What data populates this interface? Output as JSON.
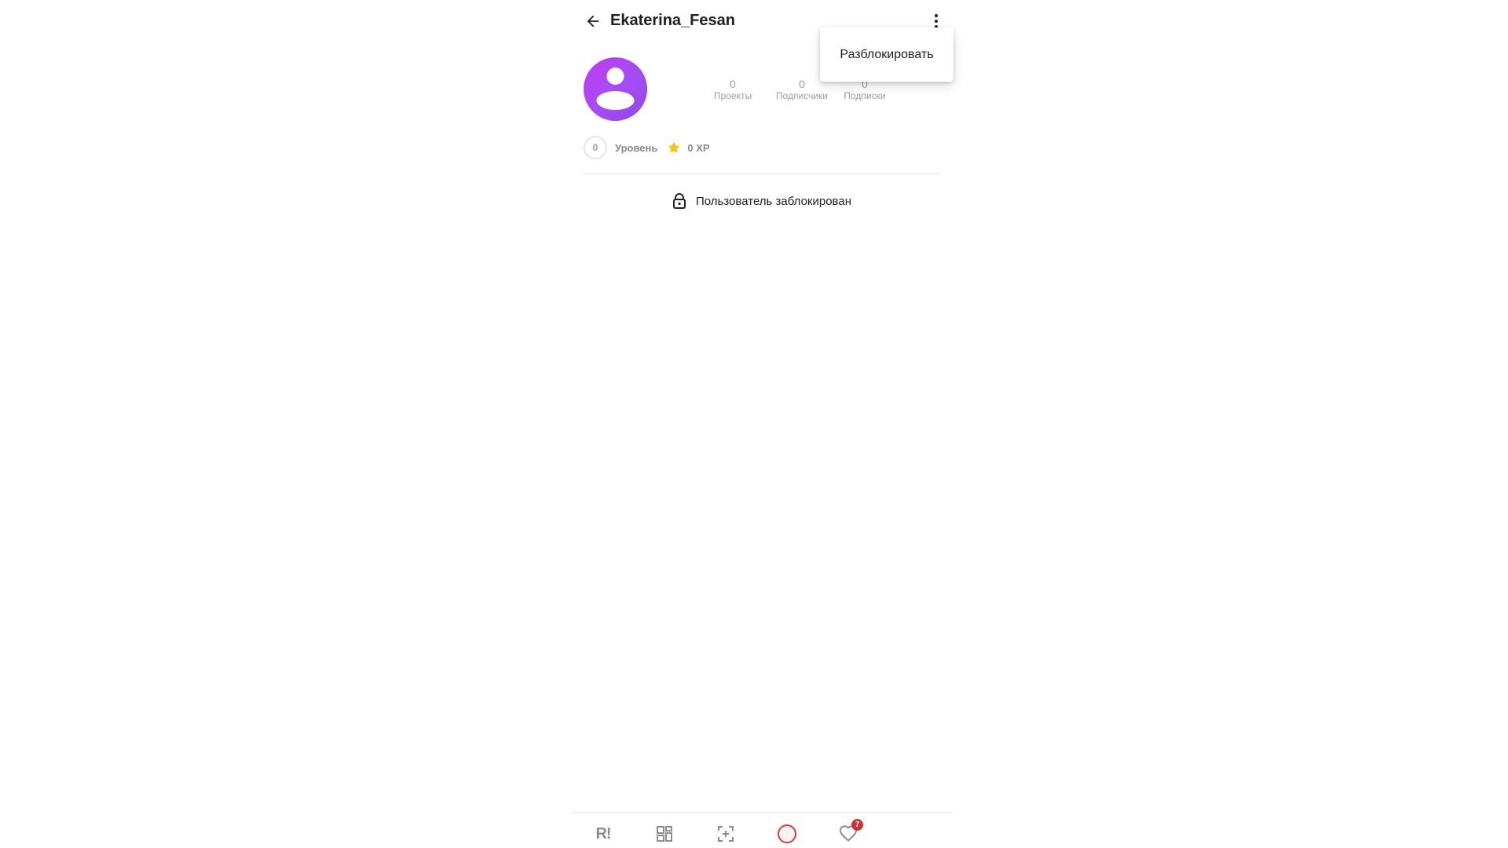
{
  "header": {
    "username": "Ekaterina_Fesan"
  },
  "menu": {
    "unblock_label": "Разблокировать"
  },
  "stats": {
    "projects": {
      "value": "0",
      "label": "Проекты"
    },
    "followers": {
      "value": "0",
      "label": "Подписчики"
    },
    "following": {
      "value": "0",
      "label": "Подписки"
    }
  },
  "level": {
    "value": "0",
    "label": "Уровень",
    "xp": "0 XP"
  },
  "blocked_message": "Пользователь заблокирован",
  "bottom_nav": {
    "logo": "R!",
    "notifications_count": "7"
  },
  "colors": {
    "avatar_gradient_start": "#c23cf2",
    "avatar_gradient_end": "#8f49e8",
    "star": "#f5c518",
    "badge": "#d32f2f",
    "profile_ring": "#e53935"
  }
}
